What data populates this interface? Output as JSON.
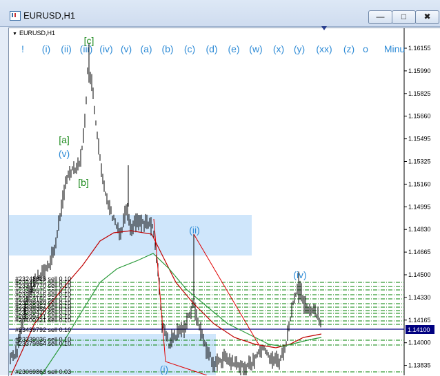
{
  "window": {
    "title": "EURUSD,H1",
    "buttons": [
      "—",
      "□",
      "✖"
    ]
  },
  "chart": {
    "symbol_label": "EURUSD,H1",
    "wave_labels": [
      "!",
      "(i)",
      "(ii)",
      "(iii)",
      "(iv)",
      "(v)",
      "(a)",
      "(b)",
      "(c)",
      "(d)",
      "(e)",
      "(w)",
      "(x)",
      "(y)",
      "(xx)",
      "(z)",
      "o",
      "Minu"
    ],
    "annotations": [
      "[c]",
      "[a]",
      "(v)",
      "[b]",
      "(ii)",
      "(iv)",
      "(i)"
    ],
    "price_ticks": [
      "1.16155",
      "1.15990",
      "1.15825",
      "1.15660",
      "1.15495",
      "1.15325",
      "1.15160",
      "1.14995",
      "1.14830",
      "1.14665",
      "1.14500",
      "1.14330",
      "1.14165",
      "1.14000",
      "1.13835"
    ],
    "current_price": "1.14100",
    "order_labels": [
      "#23248826 sell 0.10",
      "#23349575 sell 0.10",
      "#23344770 sell 0.10",
      "#23349975 sell 0.10",
      "#23351216 sell 0.10",
      "#23363155 sell 0.10",
      "#23399469 sell 0.10",
      "#23399467 sell 0.10",
      "#23399468 sell 0.10",
      "#23399470 sell 0.10",
      "#23399471 sell 0.10",
      "#23400321 sell 0.10",
      "#23439792 sell 0.10",
      "#23339036 sell 0.10",
      "#23379864 sell 0.10",
      "#23069863 sell 0.03"
    ],
    "colors": {
      "label_blue": "#2e8bd6",
      "label_green": "#1e8b1e",
      "ma_red": "#c00000",
      "ma_green": "#2a9a3a",
      "zone": "#cfe6fb",
      "order_line": "#008000",
      "price_line": "#000080"
    }
  }
}
